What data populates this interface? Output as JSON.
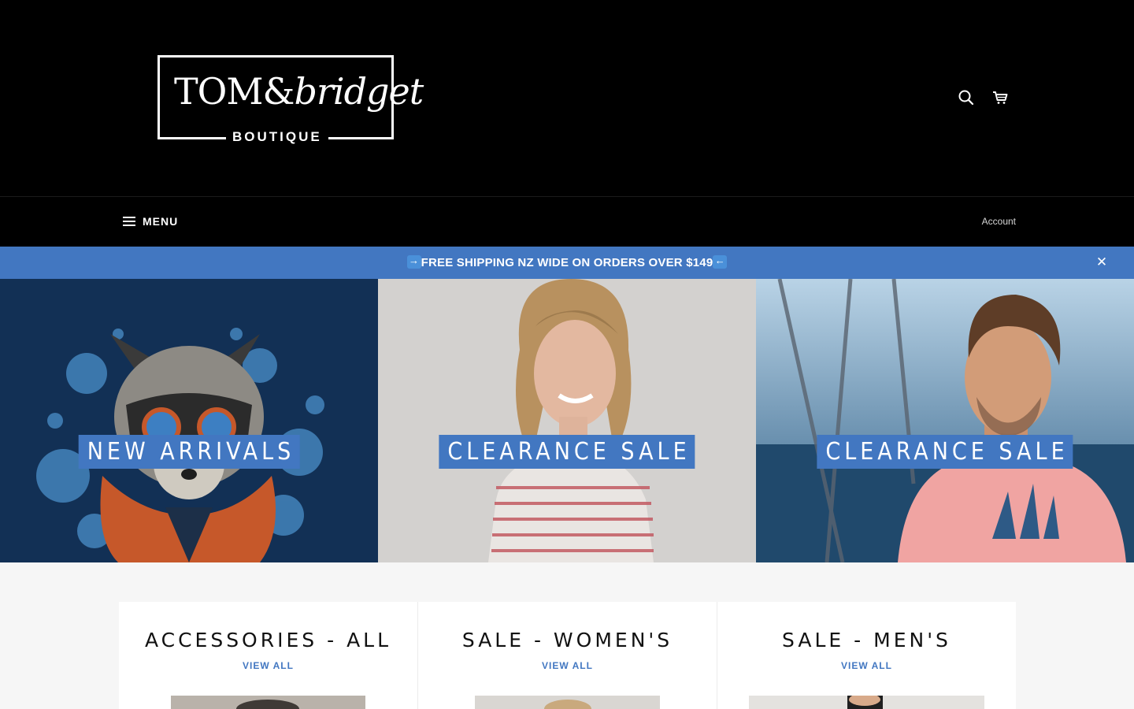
{
  "header": {
    "logo_text_primary": "TOM&",
    "logo_text_script": "bridget",
    "logo_text_secondary": "BOUTIQUE",
    "icons": [
      "search-icon",
      "cart-icon"
    ]
  },
  "nav": {
    "menu_label": "MENU",
    "account_label": "Account"
  },
  "announcement": {
    "text": "FREE SHIPPING NZ WIDE ON ORDERS OVER $149",
    "close_glyph": "✕",
    "background": "#4277c1"
  },
  "hero_tiles": [
    {
      "label": "NEW ARRIVALS"
    },
    {
      "label": "CLEARANCE SALE"
    },
    {
      "label": "CLEARANCE SALE"
    }
  ],
  "collections": [
    {
      "title": "ACCESSORIES - ALL",
      "link": "VIEW ALL"
    },
    {
      "title": "SALE - WOMEN'S",
      "link": "VIEW ALL"
    },
    {
      "title": "SALE - MEN'S",
      "link": "VIEW ALL"
    }
  ],
  "colors": {
    "accent": "#4277c1",
    "header_bg": "#000000",
    "page_bg": "#f6f6f6"
  }
}
